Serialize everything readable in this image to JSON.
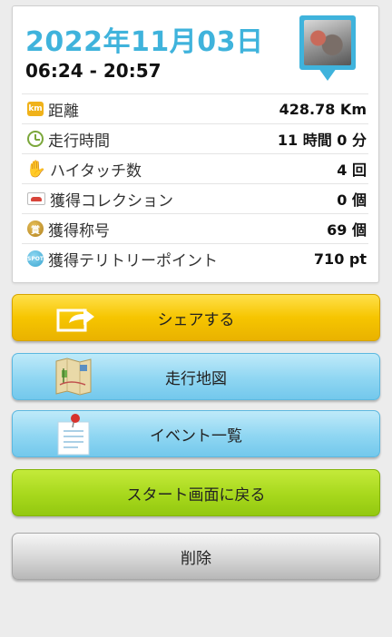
{
  "header": {
    "date": "2022年11月03日",
    "time_range": "06:24 - 20:57"
  },
  "stats": [
    {
      "icon": "km-icon",
      "label": "距離",
      "value": "428.78 Km"
    },
    {
      "icon": "clock-icon",
      "label": "走行時間",
      "value": "11 時間 0 分"
    },
    {
      "icon": "high-five-icon",
      "label": "ハイタッチ数",
      "value": "4 回"
    },
    {
      "icon": "car-card-icon",
      "label": "獲得コレクション",
      "value": "0 個"
    },
    {
      "icon": "medal-icon",
      "label": "獲得称号",
      "value": "69 個"
    },
    {
      "icon": "spot-icon",
      "label": "獲得テリトリーポイント",
      "value": "710 pt"
    }
  ],
  "icon_text": {
    "km": "km",
    "medal": "賞",
    "spot": "SPOT"
  },
  "buttons": {
    "share": "シェアする",
    "map": "走行地図",
    "events": "イベント一覧",
    "back_to_start": "スタート画面に戻る",
    "delete": "削除"
  },
  "colors": {
    "accent_blue": "#3fb3dc",
    "share_yellow": "#f6c500",
    "map_blue": "#8fd6f2",
    "start_green": "#a7d81c",
    "delete_gray": "#d9d9d9"
  }
}
